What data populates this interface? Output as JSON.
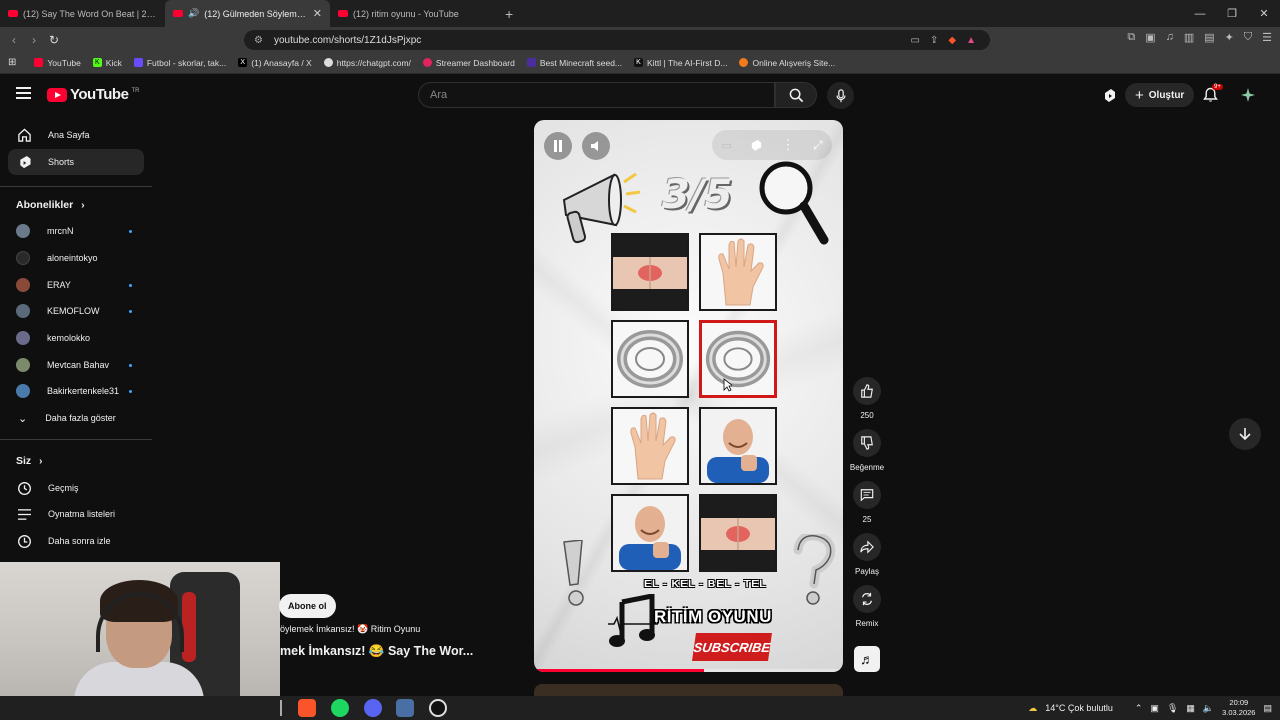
{
  "browser": {
    "tabs": [
      {
        "label": "(12) Say The Word On Beat | 2kişilik",
        "active": false
      },
      {
        "label": "(12) Gülmeden Söylemek İmk",
        "active": true
      },
      {
        "label": "(12) ritim oyunu - YouTube",
        "active": false
      }
    ],
    "url": "youtube.com/shorts/1Z1dJsPjxpc",
    "bookmarks": [
      {
        "label": "YouTube",
        "color": "#ff0033"
      },
      {
        "label": "Kick",
        "color": "#53fc18"
      },
      {
        "label": "Futbol - skorlar, tak...",
        "color": "#6a4cff"
      },
      {
        "label": "(1) Anasayfa / X",
        "color": "#000000"
      },
      {
        "label": "https://chatgpt.com/",
        "color": "#ffffff"
      },
      {
        "label": "Streamer Dashboard",
        "color": "#e0245e"
      },
      {
        "label": "Best Minecraft seed...",
        "color": "#4a2e9e"
      },
      {
        "label": "Kittl | The AI-First D...",
        "color": "#111111"
      },
      {
        "label": "Online Alışveriş Site...",
        "color": "#f27a1a"
      }
    ]
  },
  "header": {
    "logo_text": "YouTube",
    "logo_sup": "TR",
    "search_placeholder": "Ara",
    "create_label": "Oluştur",
    "notification_badge": "9+"
  },
  "sidebar": {
    "nav": [
      {
        "label": "Ana Sayfa",
        "icon": "home-icon"
      },
      {
        "label": "Shorts",
        "icon": "shorts-icon",
        "active": true
      }
    ],
    "subscriptions_title": "Abonelikler",
    "subscriptions": [
      {
        "label": "mrcnN",
        "dot": true,
        "color": "#6a7a8a"
      },
      {
        "label": "aloneintokyo",
        "dot": false,
        "color": "#2a2a2a"
      },
      {
        "label": "ERAY",
        "dot": true,
        "color": "#8a4a3a"
      },
      {
        "label": "KEMOFLOW",
        "dot": true,
        "color": "#5a6a7a"
      },
      {
        "label": "kemolokko",
        "dot": false,
        "color": "#6a6a8a"
      },
      {
        "label": "Mevtcan Bahav",
        "dot": true,
        "color": "#7a8a6a"
      },
      {
        "label": "Bakirkertenkele31",
        "dot": true,
        "color": "#4a7aaa"
      }
    ],
    "show_more": "Daha fazla göster",
    "you_title": "Siz",
    "you_items": [
      {
        "label": "Geçmiş",
        "icon": "history-icon"
      },
      {
        "label": "Oynatma listeleri",
        "icon": "playlist-icon"
      },
      {
        "label": "Daha sonra izle",
        "icon": "watch-later-icon"
      }
    ]
  },
  "short": {
    "subscribe_label": "Abone ol",
    "meta": "öylemek İmkansız! 🤡 Ritim Oyunu",
    "title": "mek İmkansız! 😂 Say The Wor...",
    "counter": "3/5",
    "grid_label": "EL - KEL - BEL - TEL",
    "brand": "RİTİM OYUNU",
    "subscribe_image": "SUBSCRIBE",
    "progress": 0.55
  },
  "actions": {
    "likes": "250",
    "dislike_label": "Beğenme",
    "comments": "25",
    "share_label": "Paylaş",
    "remix_label": "Remix"
  },
  "taskbar": {
    "weather": "14°C  Çok bulutlu",
    "time": "20:09",
    "date": "3.03.2026"
  }
}
